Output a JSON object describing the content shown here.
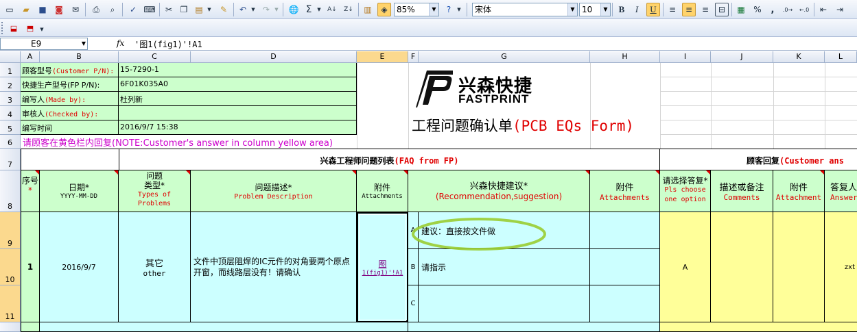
{
  "toolbar": {
    "zoom": "85%",
    "font_name": "宋体",
    "font_size": "10",
    "bold": "B",
    "italic": "I",
    "underline": "U",
    "percent": "%",
    "comma": ","
  },
  "formula_bar": {
    "name_box": "E9",
    "fx": "fx",
    "formula": "'图1(fig1)'!A1"
  },
  "columns": [
    "A",
    "B",
    "C",
    "D",
    "E",
    "F",
    "G",
    "H",
    "I",
    "J",
    "K",
    "L"
  ],
  "rows": [
    "1",
    "2",
    "3",
    "4",
    "5",
    "6",
    "7",
    "8",
    "9",
    "10",
    "11"
  ],
  "header_info": {
    "customer_pn_label": "顾客型号",
    "customer_pn_en": "(Customer P/N):",
    "customer_pn_value": "15-7290-1",
    "fp_pn_label": "快捷生产型号(FP P/N):",
    "fp_pn_value": "6F01K035A0",
    "made_by_label": "编写人",
    "made_by_en": "(Made by):",
    "made_by_value": "杜列新",
    "checked_by_label": "审核人",
    "checked_by_en": "(Checked by):",
    "checked_by_value": "",
    "time_label": "编写时间",
    "time_value": "2016/9/7 15:38",
    "note": "请顾客在黄色栏内回复(NOTE:Customer's answer in column yellow area)"
  },
  "logo": {
    "cn": "兴森快捷",
    "en": "FASTPRINT"
  },
  "form_title": {
    "cn": "工程问题确认单",
    "en": "(PCB EQs Form)"
  },
  "section": {
    "faq_cn": "兴森工程师问题列表",
    "faq_en": "(FAQ from FP)",
    "reply_cn": "顾客回复",
    "reply_en": "(Customer ans"
  },
  "table_headers": {
    "seq_cn": "序号",
    "date_cn": "日期*",
    "date_en": "YYYY-MM-DD",
    "type_cn1": "问题",
    "type_cn2": "类型*",
    "type_en1": "Types of",
    "type_en2": "Problems",
    "desc_cn": "问题描述*",
    "desc_en": "Problem Description",
    "attach_cn": "附件",
    "attach_en": "Attachments",
    "rec_cn": "兴森快捷建议*",
    "rec_en": "(Recommendation,suggestion)",
    "attach2_cn": "附件",
    "attach2_en": "Attachments",
    "choose_cn": "请选择答复*",
    "choose_en1": "Pls choose",
    "choose_en2": "one option",
    "comments_cn": "描述或备注",
    "comments_en": "Comments",
    "attach3_cn": "附件",
    "attach3_en": "Attachment",
    "answer_cn": "答复人",
    "answer_en": "Answer"
  },
  "row1": {
    "seq": "1",
    "date": "2016/9/7",
    "type_cn": "其它",
    "type_en": "other",
    "desc": "文件中顶层阻焊的IC元件的对角要两个原点开窗，而线路层没有！请确认",
    "attach_link1": "图",
    "attach_link2": "1(fig1)'!A1",
    "opt_a": "A",
    "opt_a_text": "建议：直接按文件做",
    "opt_b": "B",
    "opt_b_text": "请指示",
    "opt_c": "C",
    "choice": "A",
    "answerer": "zxt"
  }
}
